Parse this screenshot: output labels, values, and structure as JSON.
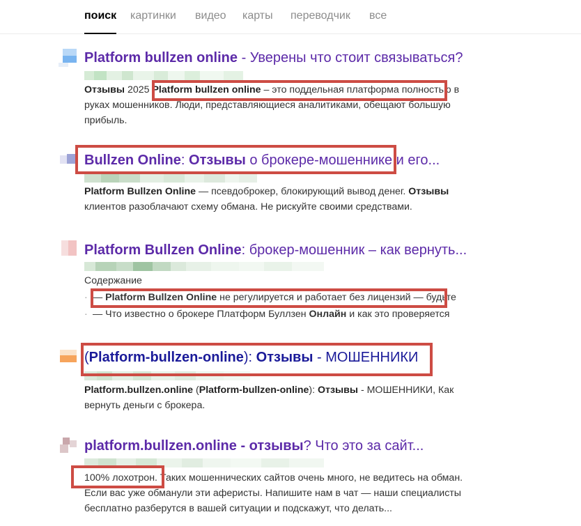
{
  "tabs": [
    {
      "label": "поиск"
    },
    {
      "label": "картинки"
    },
    {
      "label": "видео"
    },
    {
      "label": "карты"
    },
    {
      "label": "переводчик"
    },
    {
      "label": "все"
    }
  ],
  "results": [
    {
      "title_bold": "Platform bullzen online",
      "title_rest": " - Уверены что стоит связываться?",
      "snippet": {
        "l1_a": "Отзывы",
        "l1_b": " 2025 ",
        "l1_c": "Platform bullzen online",
        "l1_d": " – это поддельная платформа полностью в",
        "l2": "руках мошенников. Люди, представляющиеся аналитиками, обещают большую",
        "l3": "прибыль."
      }
    },
    {
      "title_a": "Bullzen Online",
      "title_b": ": ",
      "title_c": "Отзывы",
      "title_d": " о брокере-мошеннике и его...",
      "snippet": {
        "l1_a": "Platform Bullzen Online",
        "l1_b": " — псевдоброкер, блокирующий вывод денег. ",
        "l1_c": "Отзывы",
        "l2": "клиентов разоблачают схему обмана. Не рискуйте своими средствами."
      }
    },
    {
      "title_bold": "Platform Bullzen Online",
      "title_rest": ": брокер-мошенник – как вернуть...",
      "contents_label": "Содержание",
      "bullet1_a": "— ",
      "bullet1_b": "Platform Bullzen Online",
      "bullet1_c": " не регулируется и работает без лицензий — будьте",
      "bullet2_a": "— Что известно о брокере Платформ Буллзен ",
      "bullet2_b": "Онлайн",
      "bullet2_c": " и как это проверяется"
    },
    {
      "title_a": "(",
      "title_b": "Platform-bullzen-online",
      "title_c": "): ",
      "title_d": "Отзывы",
      "title_e": " - МОШЕННИКИ",
      "snippet": {
        "l1_a": "Platform.bullzen.online",
        "l1_b": " (",
        "l1_c": "Platform-bullzen-online",
        "l1_d": "): ",
        "l1_e": "Отзывы",
        "l1_f": " - МОШЕННИКИ, Как",
        "l2": "вернуть деньги с брокера."
      }
    },
    {
      "title_bold": "platform.bullzen.online - отзывы",
      "title_rest": "? Что это за сайт...",
      "snippet": {
        "l1_a": "100% лохотрон",
        "l1_b": ". Таких мошеннических сайтов очень много, не ведитесь на обман.",
        "l2": "Если вас уже обманули эти аферисты. Напишите нам в чат — наши специалисты",
        "l3": "бесплатно разберутся в вашей ситуации и подскажут, что делать..."
      }
    }
  ],
  "colors": {
    "title": "#5c2aa8",
    "title_navy": "#1a1a99",
    "highlight_box": "#cd4c44"
  }
}
